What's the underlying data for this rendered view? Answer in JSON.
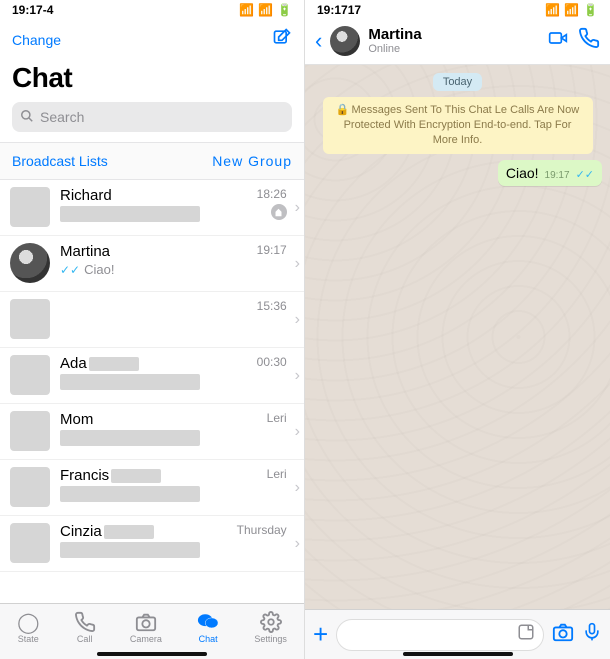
{
  "left": {
    "status_time": "19:17-4",
    "change_label": "Change",
    "title": "Chat",
    "search_placeholder": "Search",
    "broadcast_label": "Broadcast Lists",
    "new_group_label": "New Group"
  },
  "chats": [
    {
      "name": "Richard",
      "time": "18:26",
      "muted": true,
      "preview_text": "",
      "checks": false
    },
    {
      "name": "Martina",
      "time": "19:17",
      "muted": false,
      "preview_text": "Ciao!",
      "checks": true,
      "has_photo": true
    },
    {
      "name": "",
      "time": "15:36",
      "muted": false,
      "preview_text": "",
      "checks": false
    },
    {
      "name": "Ada",
      "time": "00:30",
      "muted": false,
      "preview_text": "",
      "checks": false,
      "name_blocked": true
    },
    {
      "name": "Mom",
      "time": "Leri",
      "muted": false,
      "preview_text": "",
      "checks": false
    },
    {
      "name": "Francis",
      "time": "Leri",
      "muted": false,
      "preview_text": "",
      "checks": false,
      "name_blocked": true
    },
    {
      "name": "Cinzia",
      "time": "Thursday",
      "muted": false,
      "preview_text": "",
      "checks": false,
      "name_blocked": true
    }
  ],
  "tabs": {
    "state": "State",
    "call": "Call",
    "camera": "Camera",
    "chat": "Chat",
    "settings": "Settings"
  },
  "right": {
    "status_time": "19:1717",
    "contact_name": "Martina",
    "contact_status": "Online",
    "day_label": "Today",
    "encryption_text": "Messages Sent To This Chat Le Calls Are Now Protected With Encryption End-to-end. Tap For More Info.",
    "message_text": "Ciao!",
    "message_time": "19:17"
  }
}
